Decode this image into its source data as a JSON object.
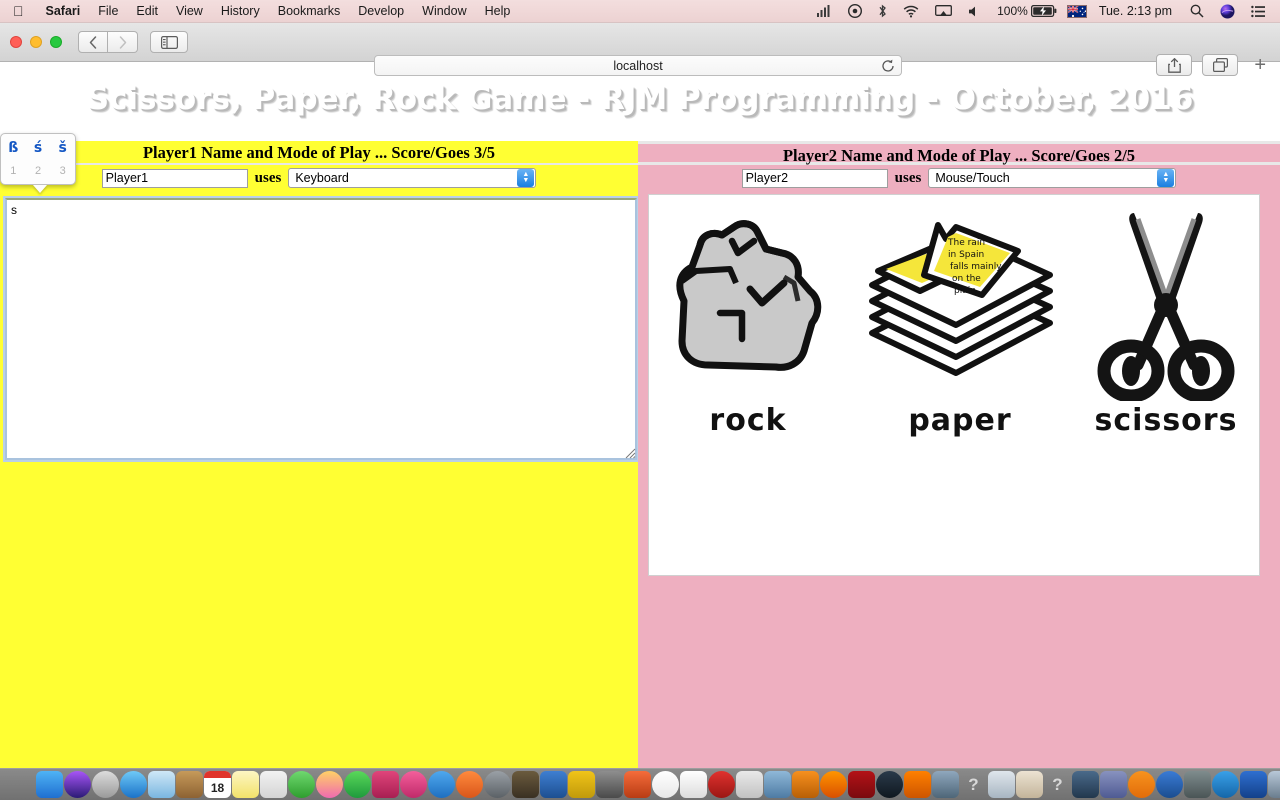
{
  "menubar": {
    "apple_icon": "apple-logo-icon",
    "items": [
      {
        "label": "Safari",
        "bold": true
      },
      {
        "label": "File",
        "bold": false
      },
      {
        "label": "Edit",
        "bold": false
      },
      {
        "label": "View",
        "bold": false
      },
      {
        "label": "History",
        "bold": false
      },
      {
        "label": "Bookmarks",
        "bold": false
      },
      {
        "label": "Develop",
        "bold": false
      },
      {
        "label": "Window",
        "bold": false
      },
      {
        "label": "Help",
        "bold": false
      }
    ],
    "status": {
      "battery_percent": "100%",
      "clock": "Tue. 2:13 pm",
      "icons": [
        "wifi-signal-icon",
        "dropbox-icon",
        "bluetooth-icon",
        "wifi-icon",
        "airplay-icon",
        "volume-icon",
        "battery-charging-icon",
        "australia-flag-icon",
        "spotlight-search-icon",
        "siri-icon",
        "notification-center-icon"
      ]
    }
  },
  "safari": {
    "traffic_lights": [
      "close-button",
      "minimize-button",
      "zoom-button"
    ],
    "back_label": "‹",
    "forward_label": "›",
    "sidebar_icon": "sidebar-toggle-icon",
    "url": "localhost",
    "reload_icon": "reload-icon",
    "share_icon": "share-icon",
    "tabs_icon": "show-all-tabs-icon",
    "newtab_label": "+"
  },
  "page": {
    "title": "Scissors, Paper, Rock Game - RJM Programming - October, 2016",
    "player1": {
      "heading": "Player1 Name and Mode of Play ... Score/Goes 3/5",
      "name_value": "Player1",
      "uses_label": "uses",
      "mode_value": "Keyboard",
      "mode_options": [
        "Keyboard",
        "Mouse/Touch"
      ],
      "textarea_value": "s",
      "panel_color": "#ffff33"
    },
    "player2": {
      "heading": "Player2 Name and Mode of Play ... Score/Goes 2/5",
      "name_value": "Player2",
      "uses_label": "uses",
      "mode_value": "Mouse/Touch",
      "mode_options": [
        "Keyboard",
        "Mouse/Touch"
      ],
      "panel_color": "#eeafc0"
    },
    "choices": [
      {
        "label": "rock",
        "icon": "rock-icon"
      },
      {
        "label": "paper",
        "icon": "paper-icon",
        "note_text": [
          "The rain",
          "in Spain",
          "falls mainly",
          "on the",
          "plain"
        ]
      },
      {
        "label": "scissors",
        "icon": "scissors-icon"
      }
    ]
  },
  "accent_popup": {
    "chars": [
      "ß",
      "ś",
      "š"
    ],
    "numbers": [
      "1",
      "2",
      "3"
    ]
  },
  "dock": {
    "items": [
      {
        "name": "finder",
        "running": true
      },
      {
        "name": "siri",
        "running": false
      },
      {
        "name": "launchpad",
        "running": false
      },
      {
        "name": "safari",
        "running": true
      },
      {
        "name": "mail",
        "running": false
      },
      {
        "name": "contacts",
        "running": false
      },
      {
        "name": "calendar",
        "running": false,
        "day": "18"
      },
      {
        "name": "notes",
        "running": false
      },
      {
        "name": "reminders",
        "running": false
      },
      {
        "name": "facetime",
        "running": false
      },
      {
        "name": "photos",
        "running": false
      },
      {
        "name": "messages",
        "running": false
      },
      {
        "name": "itunes-store",
        "running": false
      },
      {
        "name": "itunes",
        "running": false
      },
      {
        "name": "app-store",
        "running": false
      },
      {
        "name": "ibooks",
        "running": true
      },
      {
        "name": "system-preferences",
        "running": false
      },
      {
        "name": "gimp",
        "running": true
      },
      {
        "name": "xcode",
        "running": false
      },
      {
        "name": "coda",
        "running": true
      },
      {
        "name": "quicktime",
        "running": true
      },
      {
        "name": "paintbrush",
        "running": true
      },
      {
        "name": "chrome",
        "running": true
      },
      {
        "name": "textedit",
        "running": true
      },
      {
        "name": "opera",
        "running": true
      },
      {
        "name": "preview",
        "running": true
      },
      {
        "name": "image-capture",
        "running": true
      },
      {
        "name": "avast",
        "running": false
      },
      {
        "name": "firefox",
        "running": true
      },
      {
        "name": "filezilla",
        "running": true
      },
      {
        "name": "quicksilver",
        "running": true
      },
      {
        "name": "vlc",
        "running": false
      },
      {
        "name": "screen-share",
        "running": false
      },
      {
        "name": "unknown-app-1",
        "running": false
      },
      {
        "name": "package",
        "running": false
      },
      {
        "name": "addressbook-edit",
        "running": false
      },
      {
        "name": "unknown-app-2",
        "running": false
      },
      {
        "name": "virtualbox",
        "running": false
      },
      {
        "name": "php",
        "running": false
      },
      {
        "name": "xampp",
        "running": false
      },
      {
        "name": "dreamweaver",
        "running": false
      },
      {
        "name": "wireshark",
        "running": false
      },
      {
        "name": "blue-app",
        "running": false
      },
      {
        "name": "visual-studio",
        "running": false
      },
      {
        "name": "image-viewer",
        "running": false
      },
      {
        "name": "atom",
        "running": false
      },
      {
        "name": "terminal",
        "running": true
      },
      {
        "name": "github",
        "running": false
      },
      {
        "name": "keychain",
        "running": true
      }
    ],
    "files": [
      {
        "name": "downloads-stack"
      },
      {
        "name": "documents-stack"
      },
      {
        "name": "recent-items-stack"
      },
      {
        "name": "trash"
      }
    ]
  }
}
